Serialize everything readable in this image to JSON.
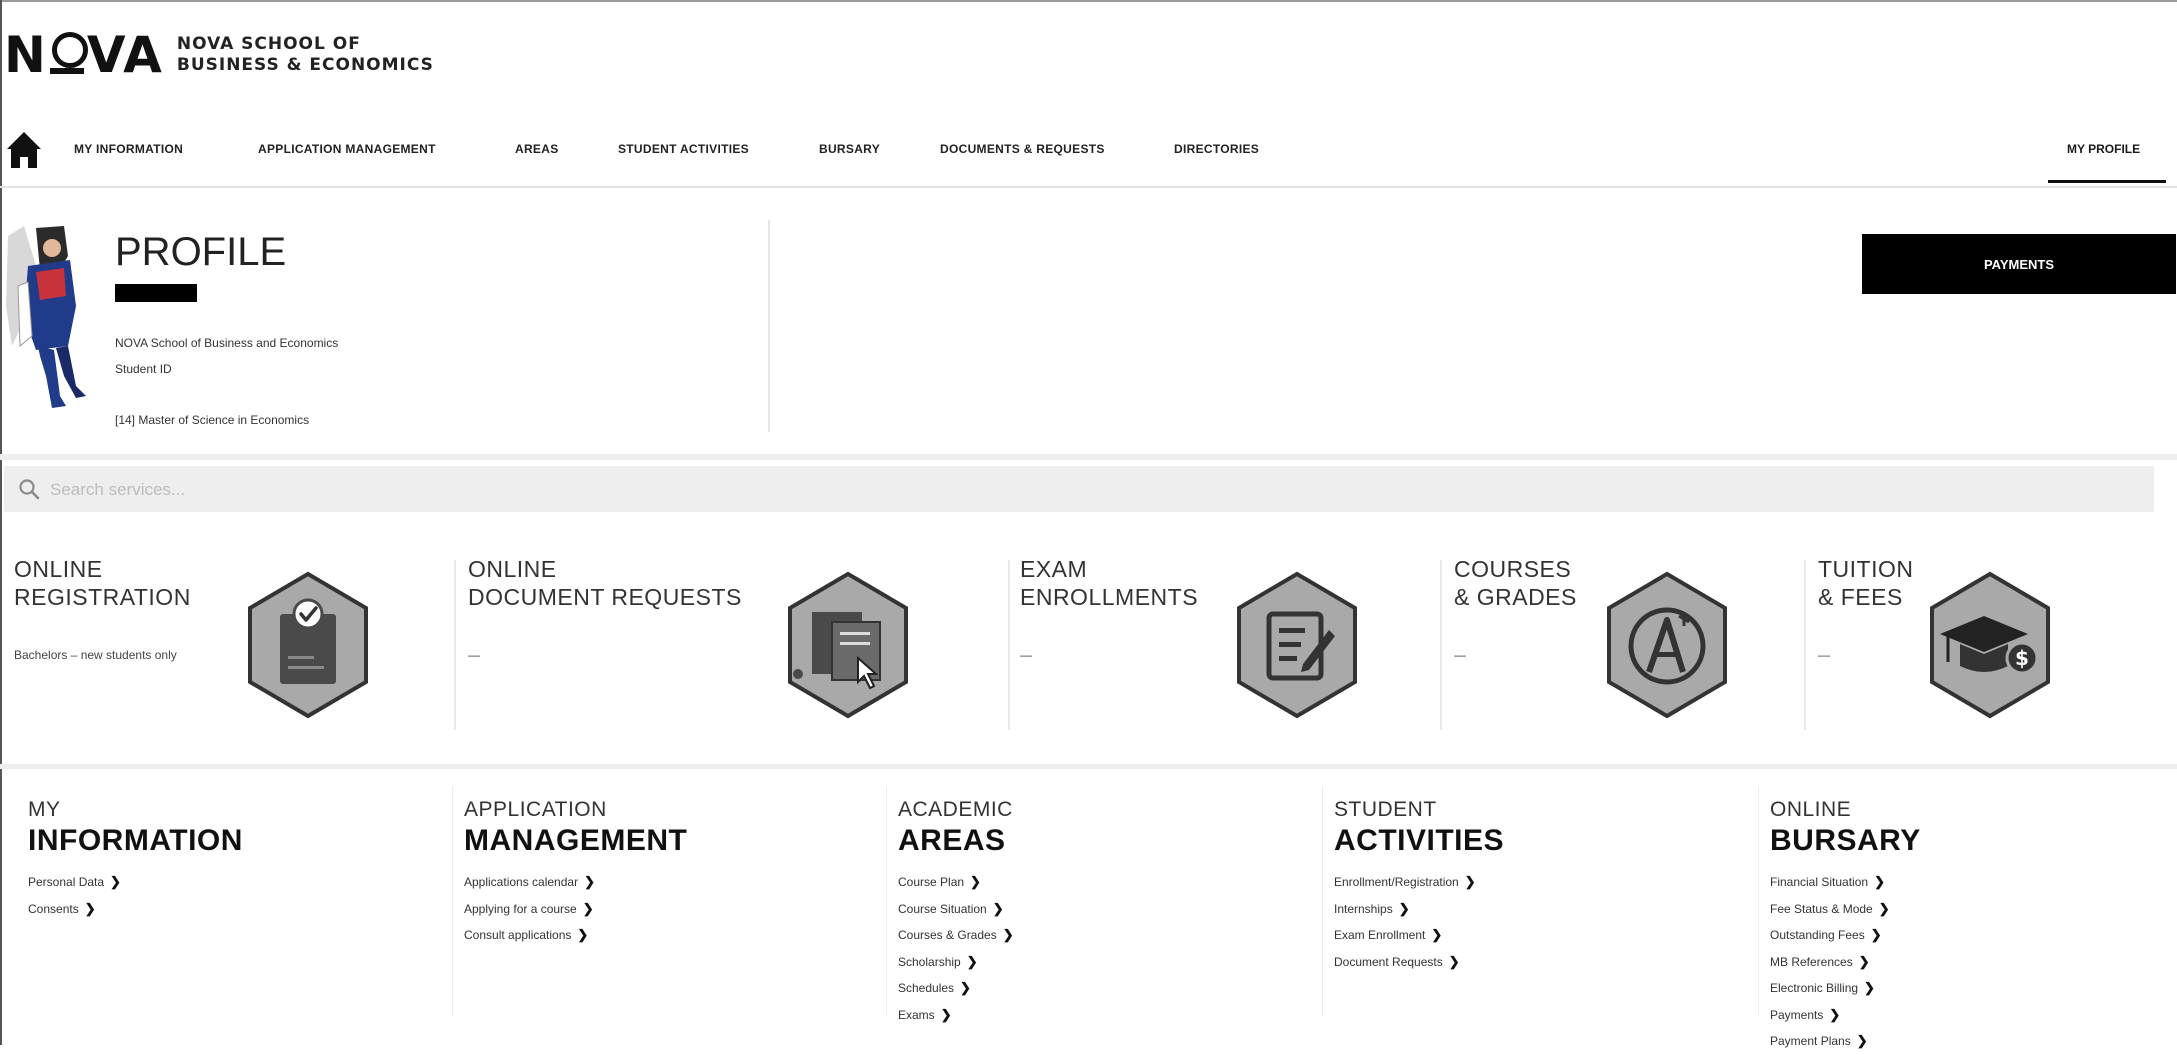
{
  "logo": {
    "word": "NOVA",
    "school_line1": "NOVA SCHOOL OF",
    "school_line2": "BUSINESS & ECONOMICS"
  },
  "nav": {
    "items": [
      "MY INFORMATION",
      "APPLICATION MANAGEMENT",
      "AREAS",
      "STUDENT ACTIVITIES",
      "BURSARY",
      "DOCUMENTS & REQUESTS",
      "DIRECTORIES"
    ],
    "profile": "MY PROFILE"
  },
  "profile": {
    "title": "PROFILE",
    "school": "NOVA School of Business and Economics",
    "student_id": "Student ID",
    "program": "[14] Master of Science in Economics",
    "payments_button": "PAYMENTS"
  },
  "search": {
    "placeholder": "Search services..."
  },
  "tiles": [
    {
      "line1": "ONLINE",
      "line2": "REGISTRATION",
      "desc": "Bachelors – new students only",
      "icon": "registration-check-icon"
    },
    {
      "line1": "ONLINE",
      "line2": "DOCUMENT REQUESTS",
      "desc": "—",
      "icon": "document-request-icon"
    },
    {
      "line1": "EXAM",
      "line2": "ENROLLMENTS",
      "desc": "—",
      "icon": "exam-enrollment-icon"
    },
    {
      "line1": "COURSES",
      "line2": "& GRADES",
      "desc": "—",
      "icon": "grades-icon"
    },
    {
      "line1": "TUITION",
      "line2": "& FEES",
      "desc": "—",
      "icon": "tuition-fees-icon"
    }
  ],
  "sections": [
    {
      "sub": "MY",
      "main": "INFORMATION",
      "links": [
        "Personal Data",
        "Consents"
      ]
    },
    {
      "sub": "APPLICATION",
      "main": "MANAGEMENT",
      "links": [
        "Applications calendar",
        "Applying for a course",
        "Consult applications"
      ]
    },
    {
      "sub": "ACADEMIC",
      "main": "AREAS",
      "links": [
        "Course Plan",
        "Course Situation",
        "Courses & Grades",
        "Scholarship",
        "Schedules",
        "Exams"
      ]
    },
    {
      "sub": "STUDENT",
      "main": "ACTIVITIES",
      "links": [
        "Enrollment/Registration",
        "Internships",
        "Exam Enrollment",
        "Document Requests"
      ]
    },
    {
      "sub": "ONLINE",
      "main": "BURSARY",
      "links": [
        "Financial Situation",
        "Fee Status & Mode",
        "Outstanding Fees",
        "MB References",
        "Electronic Billing",
        "Payments",
        "Payment Plans"
      ]
    }
  ],
  "colors": {
    "accent": "#000000",
    "hex_fill": "#a9a9a9",
    "hex_border": "#333333",
    "separator": "#eeeeee"
  }
}
